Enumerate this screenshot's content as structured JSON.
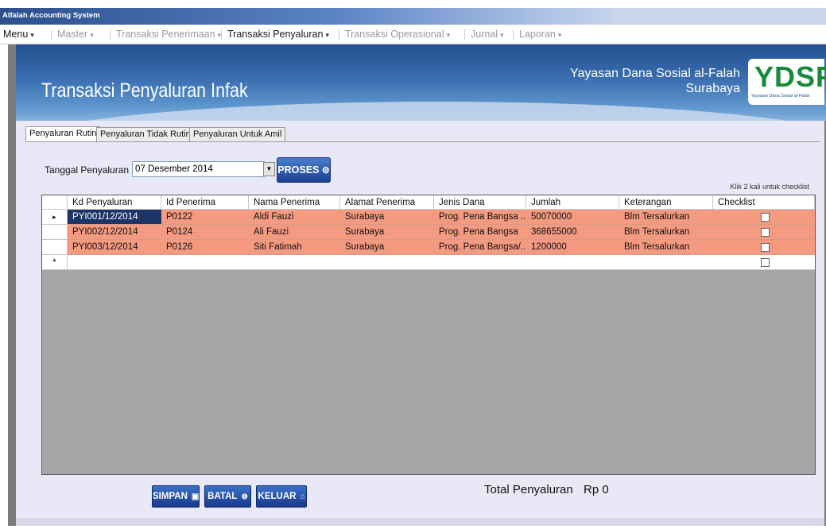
{
  "app": {
    "title": "Alfalah Accounting System"
  },
  "menu": [
    {
      "label": "Menu",
      "enabled": true
    },
    {
      "label": "Master",
      "enabled": false
    },
    {
      "label": "Transaksi Penerimaan",
      "enabled": false
    },
    {
      "label": "Transaksi Penyaluran",
      "enabled": true
    },
    {
      "label": "Transaksi Operasional",
      "enabled": false
    },
    {
      "label": "Jurnal",
      "enabled": false
    },
    {
      "label": "Laporan",
      "enabled": false
    }
  ],
  "header": {
    "form_title": "Transaksi Penyaluran Infak",
    "org_line1": "Yayasan Dana Sosial al-Falah",
    "org_line2": "Surabaya",
    "logo_text": "YDSF",
    "logo_subtext": "Yayasan Dana Sosial al-Falah"
  },
  "tabs": [
    {
      "label": "Penyaluran Rutin",
      "active": true
    },
    {
      "label": "Penyaluran Tidak Rutin",
      "active": false
    },
    {
      "label": "Penyaluran Untuk Amil",
      "active": false
    }
  ],
  "form": {
    "date_label": "Tanggal Penyaluran",
    "date_value": "07 Desember 2014",
    "proses_label": "PROSES",
    "hint": "Klik 2 kali untuk checklist"
  },
  "grid": {
    "columns": [
      "Kd Penyaluran",
      "Id Penerima",
      "Nama Penerima",
      "Alamat Penerima",
      "Jenis Dana",
      "Jumlah",
      "Keterangan",
      "Checklist"
    ],
    "rows": [
      [
        "PYI001/12/2014",
        "P0122",
        "Aldi Fauzi",
        "Surabaya",
        "Prog. Pena Bangsa ...",
        "50070000",
        "Blm Tersalurkan"
      ],
      [
        "PYI002/12/2014",
        "P0124",
        "Ali Fauzi",
        "Surabaya",
        "Prog. Pena Bangsa",
        "368655000",
        "Blm Tersalurkan"
      ],
      [
        "PYI003/12/2014",
        "P0126",
        "Siti Fatimah",
        "Surabaya",
        "Prog. Pena Bangsa/...",
        "1200000",
        "Blm Tersalurkan"
      ]
    ],
    "current_row_marker": "▸",
    "new_row_marker": "*",
    "row_color": "#f49a80"
  },
  "buttons": {
    "simpan": "SIMPAN",
    "batal": "BATAL",
    "keluar": "KELUAR"
  },
  "total": {
    "label": "Total Penyaluran",
    "value": "Rp 0"
  },
  "icons": {
    "proses": "gear-icon",
    "simpan": "disk-icon",
    "batal": "cancel-icon",
    "keluar": "home-icon"
  },
  "colors": {
    "accent": "#1c3f8f",
    "row_highlight": "#f49a80",
    "selected_cell": "#1d3566"
  }
}
